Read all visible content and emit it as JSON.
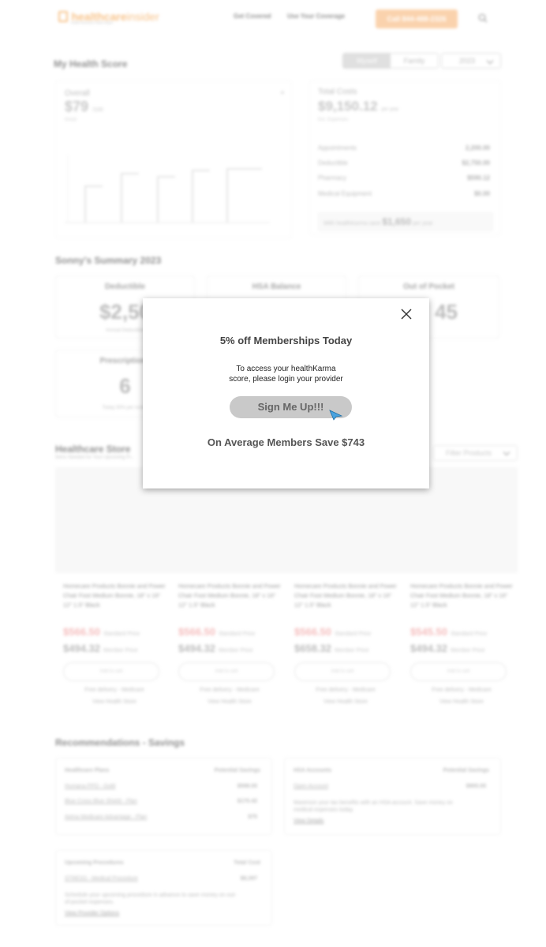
{
  "header": {
    "logo_main": "healthcare",
    "logo_accent": "insider",
    "logo_tagline": "health insurance made simple",
    "nav": [
      "Get Covered",
      "Use Your Coverage"
    ],
    "call_label": "Call 844-488-2326"
  },
  "health_score": {
    "title": "My Health Score",
    "toggle": [
      "Myself",
      "Family"
    ],
    "year": "2023",
    "overall_label": "Overall",
    "overall_value": "$79",
    "overall_suffix": "/100",
    "overall_sub": "Good",
    "total_costs_label": "Total Costs",
    "total_costs_value": "$9,150.12",
    "total_costs_suffix": "per year",
    "total_costs_sub": "Est. Expenses",
    "cost_rows": [
      {
        "label": "Appointments",
        "value": "2,200.00"
      },
      {
        "label": "Deductible",
        "value": "$2,750.00"
      },
      {
        "label": "Pharmacy",
        "value": "$590.12"
      },
      {
        "label": "Medical Equipment",
        "value": "$0.00"
      }
    ],
    "savings_prefix": "With healthKarma save",
    "savings_value": "$1,650",
    "savings_suffix": "per year"
  },
  "summary": {
    "title": "Sonny's Summary 2023",
    "cards": [
      {
        "label": "Deductible",
        "value": "$2,50",
        "sub": "Annual Deductible"
      },
      {
        "label": "HSA Balance",
        "value": "",
        "sub": ""
      },
      {
        "label": "Out of Pocket",
        "value": "45",
        "sub": ""
      },
      {
        "label": "Prescriptions",
        "value": "6",
        "sub": "Today 30% per month"
      }
    ]
  },
  "store": {
    "title": "Healthcare Store",
    "subtitle": "Items Needed for Your Upcoming Pr...",
    "filter_label": "Filter Products",
    "products": [
      {
        "name": "Homecare Products Bonnie and Power Chair Foot Medium Bonnie, 18\" x 16\" 12\" 1.5\" Black",
        "sale": "$566.50",
        "sale_label": "Standard Price",
        "price": "$494.32",
        "price_label": "Member Price",
        "button": "Add to cart",
        "link1": "Free delivery - Medicare",
        "link2": "View Health Store"
      },
      {
        "name": "Homecare Products Bonnie and Power Chair Foot Medium Bonnie, 18\" x 16\" 12\" 1.5\" Black",
        "sale": "$566.50",
        "sale_label": "Standard Price",
        "price": "$494.32",
        "price_label": "Member Price",
        "button": "Add to cart",
        "link1": "Free delivery - Medicare",
        "link2": "View Health Store"
      },
      {
        "name": "Homecare Products Bonnie and Power Chair Foot Medium Bonnie, 18\" x 16\" 12\" 1.5\" Black",
        "sale": "$566.50",
        "sale_label": "Standard Price",
        "price": "$658.32",
        "price_label": "Member Price",
        "button": "Add to cart",
        "link1": "Free delivery - Medicare",
        "link2": "View Health Store"
      },
      {
        "name": "Homecare Products Bonnie and Power Chair Foot Medium Bonnie, 18\" x 16\" 12\" 1.5\" Black",
        "sale": "$545.50",
        "sale_label": "Standard Price",
        "price": "$494.32",
        "price_label": "Member Price",
        "button": "Add to cart",
        "link1": "Free delivery - Medicare",
        "link2": "View Health Store"
      }
    ]
  },
  "recommendations": {
    "title": "Recommendations - Savings",
    "card1": {
      "head_left": "Healthcare Plans",
      "head_right": "Potential Savings",
      "rows": [
        {
          "label": "Humana PPO - Gold",
          "value": "$598.00"
        },
        {
          "label": "Blue Cross Blue Shield - Plan",
          "value": "$170.42"
        },
        {
          "label": "Aetna Medicare Advantage - Plan",
          "value": "$75"
        }
      ]
    },
    "card2": {
      "head_left": "HSA Accounts",
      "head_right": "Potential Savings",
      "rows": [
        {
          "label": "Open Account",
          "value": "$900.00"
        }
      ],
      "note": "Maximize your tax benefits with an HSA account. Save money on medical expenses today.",
      "link": "View Details"
    },
    "card3": {
      "head_left": "Upcoming Procedures",
      "head_right": "Total Cost",
      "rows": [
        {
          "label": "STRESS - Medical Procedure",
          "value": "$8,397"
        }
      ],
      "note": "Schedule your upcoming procedure in advance to save money on out-of-pocket expenses.",
      "link": "View Provider Options"
    }
  },
  "modal": {
    "title": "5% off Memberships Today",
    "text_line1": "To access your healthKarma",
    "text_line2": "score, please login your provider",
    "button_label": "Sign Me Up!!!",
    "footer": "On Average Members Save $743"
  },
  "colors": {
    "brand_orange": "#f3a24a",
    "call_button": "#f8bb82",
    "modal_button": "#c9c9c9",
    "sale_price": "#ef9a9a"
  }
}
